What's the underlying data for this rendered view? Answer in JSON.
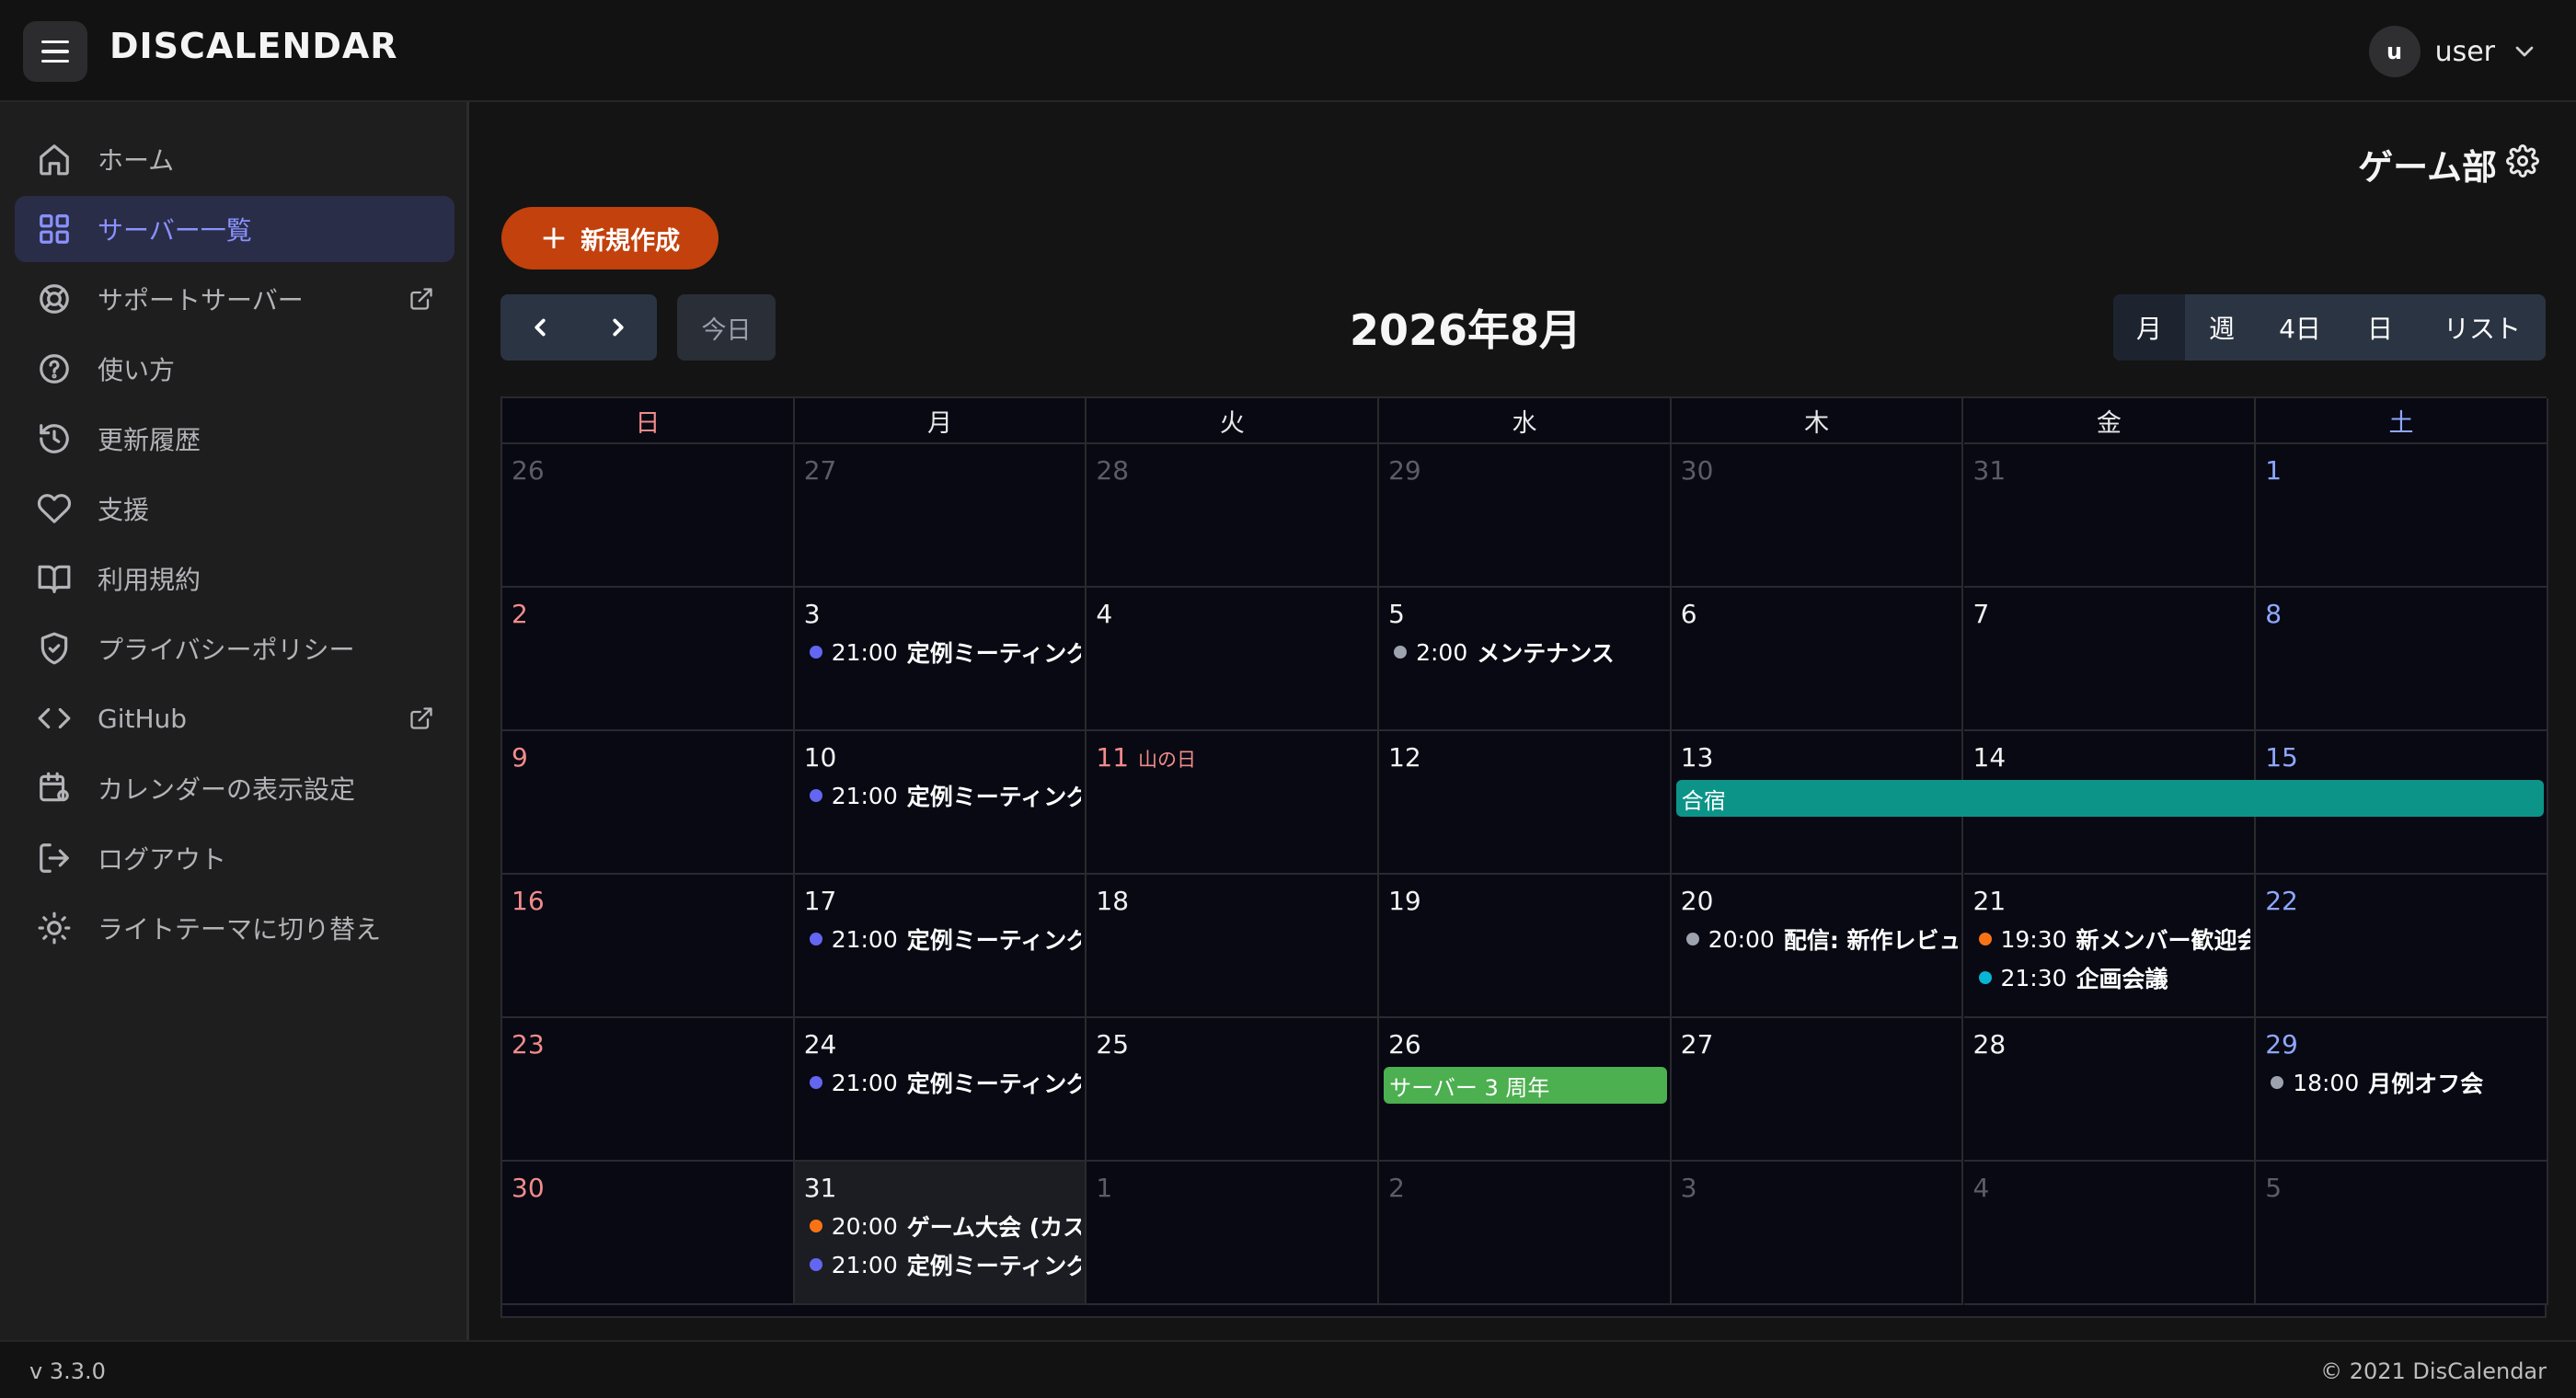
{
  "header": {
    "brand": "DISCALENDAR",
    "user": {
      "initial": "u",
      "name": "user"
    }
  },
  "sidebar": {
    "items": [
      {
        "label": "ホーム",
        "icon": "home-icon"
      },
      {
        "label": "サーバー一覧",
        "icon": "grid-icon",
        "active": true
      },
      {
        "label": "サポートサーバー",
        "icon": "lifebuoy-icon",
        "external": true
      },
      {
        "label": "使い方",
        "icon": "help-icon"
      },
      {
        "label": "更新履歴",
        "icon": "history-icon"
      },
      {
        "label": "支援",
        "icon": "heart-icon"
      },
      {
        "label": "利用規約",
        "icon": "book-icon"
      },
      {
        "label": "プライバシーポリシー",
        "icon": "shield-icon"
      },
      {
        "label": "GitHub",
        "icon": "code-icon",
        "external": true
      },
      {
        "label": "カレンダーの表示設定",
        "icon": "calendar-settings-icon"
      },
      {
        "label": "ログアウト",
        "icon": "logout-icon"
      },
      {
        "label": "ライトテーマに切り替え",
        "icon": "sun-icon"
      }
    ]
  },
  "main": {
    "server_name": "ゲーム部",
    "new_button": "新規作成",
    "today_button": "今日",
    "month_title": "2026年8月",
    "views": [
      "月",
      "週",
      "4日",
      "日",
      "リスト"
    ],
    "active_view": "月"
  },
  "calendar": {
    "weekdays": [
      "日",
      "月",
      "火",
      "水",
      "木",
      "金",
      "土"
    ],
    "weeks": [
      [
        {
          "d": "26",
          "o": true
        },
        {
          "d": "27",
          "o": true
        },
        {
          "d": "28",
          "o": true
        },
        {
          "d": "29",
          "o": true
        },
        {
          "d": "30",
          "o": true
        },
        {
          "d": "31",
          "o": true
        },
        {
          "d": "1"
        }
      ],
      [
        {
          "d": "2"
        },
        {
          "d": "3",
          "events": [
            {
              "time": "21:00",
              "title": "定例ミーティング",
              "color": "#6366f1"
            }
          ]
        },
        {
          "d": "4"
        },
        {
          "d": "5",
          "events": [
            {
              "time": "2:00",
              "title": "メンテナンス",
              "color": "#9ca3af"
            }
          ]
        },
        {
          "d": "6"
        },
        {
          "d": "7"
        },
        {
          "d": "8"
        }
      ],
      [
        {
          "d": "9"
        },
        {
          "d": "10",
          "events": [
            {
              "time": "21:00",
              "title": "定例ミーティング",
              "color": "#6366f1"
            }
          ]
        },
        {
          "d": "11",
          "holiday": "山の日"
        },
        {
          "d": "12"
        },
        {
          "d": "13"
        },
        {
          "d": "14"
        },
        {
          "d": "15"
        }
      ],
      [
        {
          "d": "16"
        },
        {
          "d": "17",
          "events": [
            {
              "time": "21:00",
              "title": "定例ミーティング",
              "color": "#6366f1"
            }
          ]
        },
        {
          "d": "18"
        },
        {
          "d": "19"
        },
        {
          "d": "20",
          "events": [
            {
              "time": "20:00",
              "title": "配信: 新作レビュー",
              "color": "#9ca3af"
            }
          ]
        },
        {
          "d": "21",
          "events": [
            {
              "time": "19:30",
              "title": "新メンバー歓迎会",
              "color": "#f97316"
            },
            {
              "time": "21:30",
              "title": "企画会議",
              "color": "#06b6d4"
            }
          ]
        },
        {
          "d": "22"
        }
      ],
      [
        {
          "d": "23"
        },
        {
          "d": "24",
          "events": [
            {
              "time": "21:00",
              "title": "定例ミーティング",
              "color": "#6366f1"
            }
          ]
        },
        {
          "d": "25"
        },
        {
          "d": "26"
        },
        {
          "d": "27"
        },
        {
          "d": "28"
        },
        {
          "d": "29",
          "events": [
            {
              "time": "18:00",
              "title": "月例オフ会",
              "color": "#9ca3af"
            }
          ]
        }
      ],
      [
        {
          "d": "30"
        },
        {
          "d": "31",
          "today": true,
          "events": [
            {
              "time": "20:00",
              "title": "ゲーム大会 (カスタム",
              "color": "#f97316"
            },
            {
              "time": "21:00",
              "title": "定例ミーティング",
              "color": "#6366f1"
            }
          ]
        },
        {
          "d": "1",
          "o": true
        },
        {
          "d": "2",
          "o": true
        },
        {
          "d": "3",
          "o": true
        },
        {
          "d": "4",
          "o": true
        },
        {
          "d": "5",
          "o": true
        }
      ]
    ],
    "bars": [
      {
        "title": "合宿",
        "week": 2,
        "start": 4,
        "end": 6,
        "color": "#0d9488"
      },
      {
        "title": "サーバー 3 周年",
        "week": 4,
        "start": 3,
        "end": 3,
        "color": "#4caf50"
      }
    ]
  },
  "footer": {
    "version": "v 3.3.0",
    "copyright": "© 2021 DisCalendar"
  }
}
